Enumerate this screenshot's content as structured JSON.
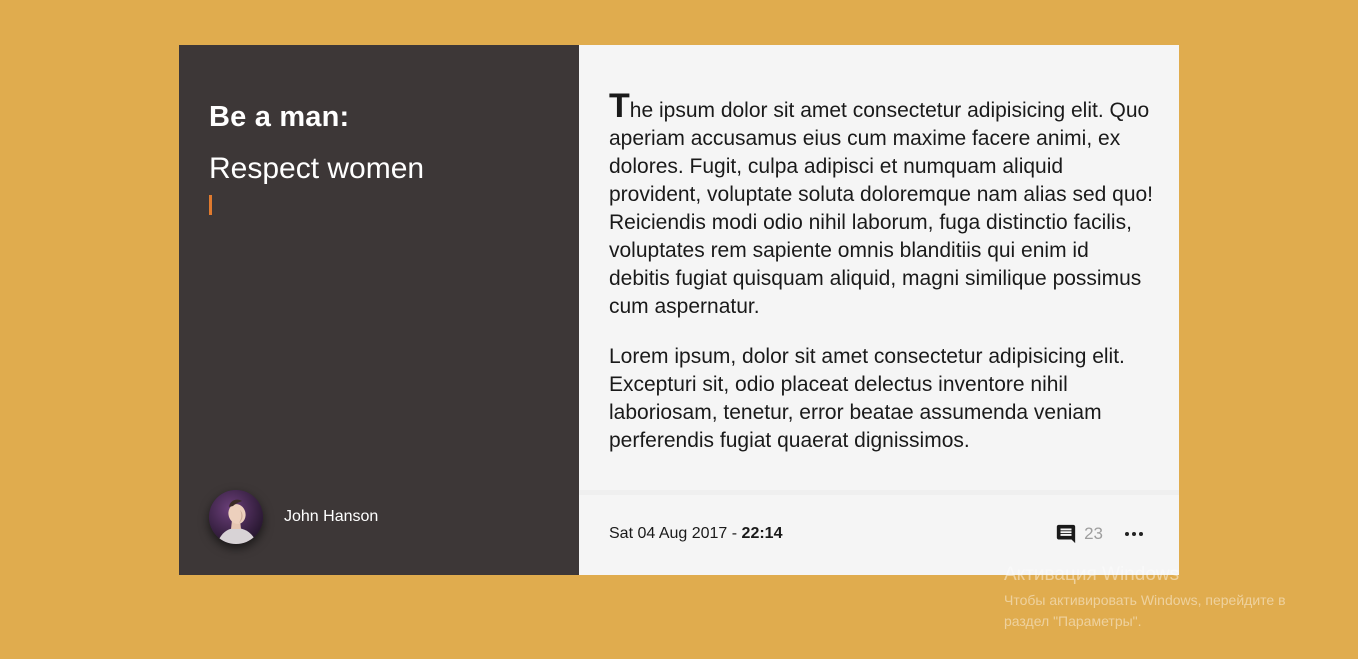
{
  "post": {
    "title": "Be a man:",
    "subtitle": "Respect women",
    "author": {
      "name": "John Hanson"
    },
    "paragraphs": {
      "first_letter": "T",
      "first_rest": "he ipsum dolor sit amet consectetur adipisicing elit. Quo aperiam accusamus eius cum maxime facere animi, ex dolores. Fugit, culpa adipisci et numquam aliquid provident, voluptate soluta doloremque nam alias sed quo! Reiciendis modi odio nihil laborum, fuga distinctio facilis, voluptates rem sapiente omnis blanditiis qui enim id debitis fugiat quisquam aliquid, magni similique possimus cum aspernatur.",
      "second": "Lorem ipsum, dolor sit amet consectetur adipisicing elit. Excepturi sit, odio placeat delectus inventore nihil laboriosam, tenetur, error beatae assumenda veniam perferendis fugiat quaerat dignissimos."
    },
    "footer": {
      "date": "Sat 04 Aug 2017 - ",
      "time": "22:14",
      "comment_count": "23",
      "comment_icon": "comment-icon",
      "more_icon": "more-horizontal-icon"
    }
  },
  "windows_watermark": {
    "title": "Активация Windows",
    "subtitle": "Чтобы активировать Windows, перейдите в раздел \"Параметры\"."
  },
  "colors": {
    "background": "#E0AC4E",
    "left_panel": "#3D3737",
    "right_panel": "#F5F5F5",
    "accent": "#E07A2E"
  }
}
